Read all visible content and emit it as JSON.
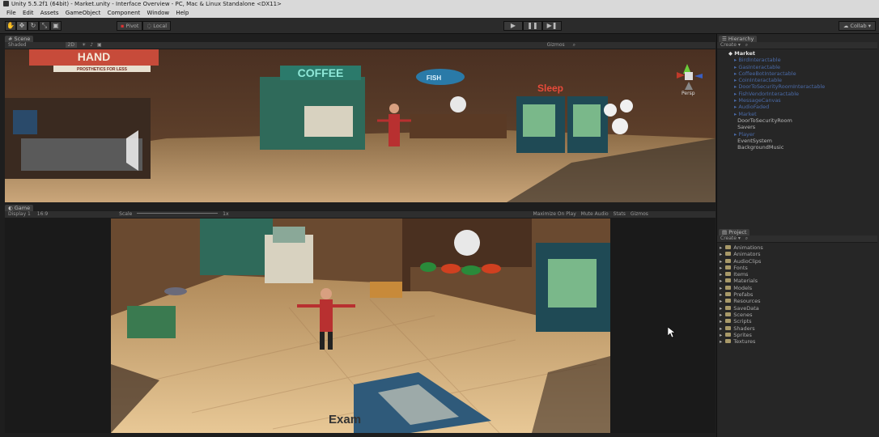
{
  "window": {
    "title": "Unity 5.5.2f1 (64bit) - Market.unity - Interface Overview - PC, Mac & Linux Standalone <DX11>"
  },
  "menu": [
    "File",
    "Edit",
    "Assets",
    "GameObject",
    "Component",
    "Window",
    "Help"
  ],
  "toolbar": {
    "pivot": "Pivot",
    "local": "Local",
    "collab": "Collab"
  },
  "scene": {
    "tab": "Scene",
    "shading": "Shaded",
    "mode2d": "2D",
    "gizmos": "Gizmos",
    "persp": "Persp",
    "signs": {
      "hand": "HAND",
      "prosthetics": "PROSTHETICS FOR LESS",
      "coffee": "COFFEE",
      "fish": "FISH",
      "sleep": "Sleep"
    }
  },
  "game": {
    "tab": "Game",
    "display": "Display 1",
    "aspect": "16:9",
    "scale_label": "Scale",
    "scale_value": "1x",
    "toggles": [
      "Maximize On Play",
      "Mute Audio",
      "Stats",
      "Gizmos"
    ]
  },
  "hierarchy": {
    "tab": "Hierarchy",
    "create": "Create",
    "root": "Market",
    "items": [
      {
        "label": "BirdInteractable",
        "style": "blue"
      },
      {
        "label": "GasInteractable",
        "style": "blue"
      },
      {
        "label": "CoffeeBotInteractable",
        "style": "blue"
      },
      {
        "label": "CoinInteractable",
        "style": "blue"
      },
      {
        "label": "DoorToSecurityRoomInteractable",
        "style": "blue"
      },
      {
        "label": "FishVendorInteractable",
        "style": "blue"
      },
      {
        "label": "MessageCanvas",
        "style": "blue"
      },
      {
        "label": "AudioFaded",
        "style": "blue"
      },
      {
        "label": "Market",
        "style": "blue"
      },
      {
        "label": "DoorToSecurityRoom",
        "style": "plain"
      },
      {
        "label": "Savers",
        "style": "plain"
      },
      {
        "label": "Player",
        "style": "blue"
      },
      {
        "label": "EventSystem",
        "style": "plain"
      },
      {
        "label": "BackgroundMusic",
        "style": "plain"
      }
    ]
  },
  "project": {
    "tab": "Project",
    "create": "Create",
    "folders": [
      "Animations",
      "Animators",
      "AudioClips",
      "Fonts",
      "Items",
      "Materials",
      "Models",
      "Prefabs",
      "Resources",
      "SaveData",
      "Scenes",
      "Scripts",
      "Shaders",
      "Sprites",
      "Textures"
    ]
  },
  "caption": "Exam"
}
